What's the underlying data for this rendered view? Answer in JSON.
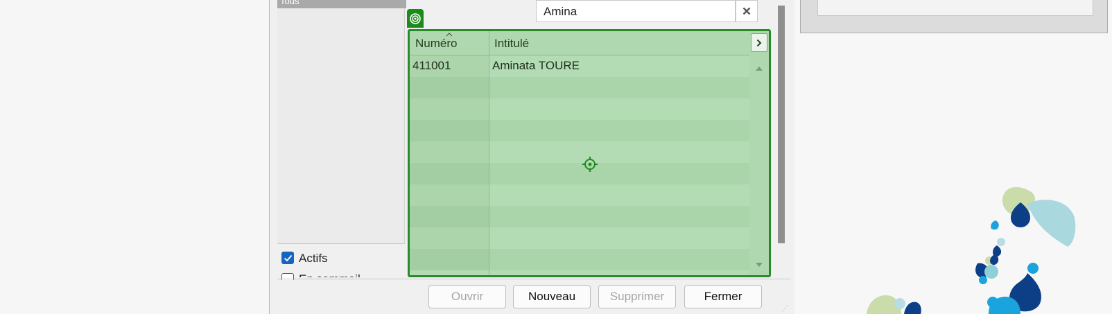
{
  "left_panel": {
    "selected_item": "Tous",
    "checkbox_actifs": {
      "label": "Actifs",
      "checked": true
    },
    "checkbox_second": {
      "label": "En sommeil",
      "checked": false
    }
  },
  "search": {
    "value": "Amina",
    "clear_icon": "close-icon"
  },
  "grid": {
    "columns": [
      "Numéro",
      "Intitulé"
    ],
    "sort_indicator_icon": "sort-up-icon",
    "expand_icon": "chevron-right-icon",
    "rows": [
      {
        "numero": "411001",
        "intitule": "Aminata TOURE"
      }
    ]
  },
  "buttons": {
    "ouvrir": "Ouvrir",
    "nouveau": "Nouveau",
    "supprimer": "Supprimer",
    "fermer": "Fermer"
  },
  "overlay": {
    "tag_icon": "target-icon",
    "center_icon": "crosshair-icon",
    "highlight_color": "#2a8a2a"
  },
  "colors": {
    "checkbox_accent": "#1565c0",
    "logo_light_green": "#c9dcaa",
    "logo_dark_blue": "#0d3f87",
    "logo_light_blue": "#8fd0d8",
    "logo_cyan": "#1aa3dc"
  }
}
